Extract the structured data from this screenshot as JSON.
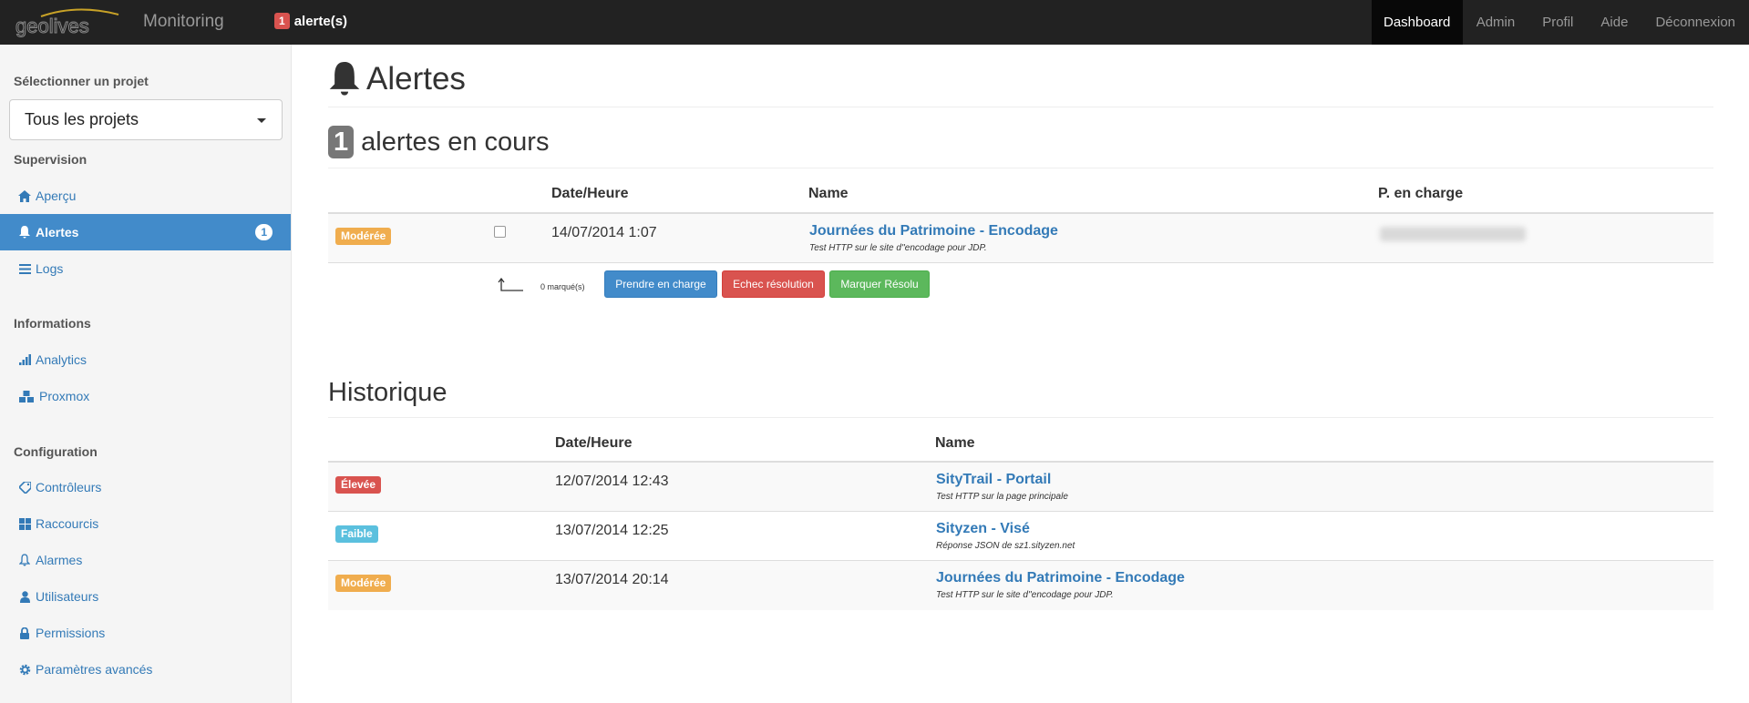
{
  "navbar": {
    "brand": "Monitoring",
    "logo_text": "geolives",
    "alert_count": "1",
    "alert_label": "alerte(s)",
    "items": [
      {
        "label": "Dashboard",
        "active": true
      },
      {
        "label": "Admin",
        "active": false
      },
      {
        "label": "Profil",
        "active": false
      },
      {
        "label": "Aide",
        "active": false
      },
      {
        "label": "Déconnexion",
        "active": false
      }
    ]
  },
  "sidebar": {
    "project_heading": "Sélectionner un projet",
    "project_selected": "Tous les projets",
    "sections": [
      {
        "heading": "Supervision",
        "items": [
          {
            "label": "Aperçu",
            "icon": "home-icon"
          },
          {
            "label": "Alertes",
            "icon": "bell-icon",
            "active": true,
            "badge": "1"
          },
          {
            "label": "Logs",
            "icon": "list-icon"
          }
        ]
      },
      {
        "heading": "Informations",
        "items": [
          {
            "label": "Analytics",
            "icon": "signal-icon"
          },
          {
            "label": "Proxmox",
            "icon": "cubes-icon"
          }
        ]
      },
      {
        "heading": "Configuration",
        "items": [
          {
            "label": "Contrôleurs",
            "icon": "tag-icon"
          },
          {
            "label": "Raccourcis",
            "icon": "grid-icon"
          },
          {
            "label": "Alarmes",
            "icon": "bell-outline-icon"
          },
          {
            "label": "Utilisateurs",
            "icon": "user-icon"
          },
          {
            "label": "Permissions",
            "icon": "lock-icon"
          },
          {
            "label": "Paramètres avancés",
            "icon": "cog-icon"
          }
        ]
      }
    ]
  },
  "main": {
    "title": "Alertes",
    "current": {
      "count": "1",
      "label": "alertes en cours",
      "headers": {
        "date": "Date/Heure",
        "name": "Name",
        "owner": "P. en charge"
      },
      "rows": [
        {
          "severity": "Modérée",
          "severity_color": "#f0ad4e",
          "date": "14/07/2014 1:07",
          "name": "Journées du Patrimoine - Encodage",
          "desc": "Test HTTP sur le site d''encodage pour JDP."
        }
      ],
      "marked": "0 marqué(s)",
      "buttons": {
        "take": "Prendre en charge",
        "fail": "Echec résolution",
        "resolve": "Marquer Résolu"
      }
    },
    "history": {
      "title": "Historique",
      "headers": {
        "date": "Date/Heure",
        "name": "Name"
      },
      "rows": [
        {
          "severity": "Élevée",
          "severity_color": "#d9534f",
          "date": "12/07/2014 12:43",
          "name": "SityTrail - Portail",
          "desc": "Test HTTP sur la page principale"
        },
        {
          "severity": "Faible",
          "severity_color": "#5bc0de",
          "date": "13/07/2014 12:25",
          "name": "Sityzen - Visé",
          "desc": "Réponse JSON de sz1.sityzen.net"
        },
        {
          "severity": "Modérée",
          "severity_color": "#f0ad4e",
          "date": "13/07/2014 20:14",
          "name": "Journées du Patrimoine - Encodage",
          "desc": "Test HTTP sur le site d''encodage pour JDP."
        }
      ]
    }
  }
}
